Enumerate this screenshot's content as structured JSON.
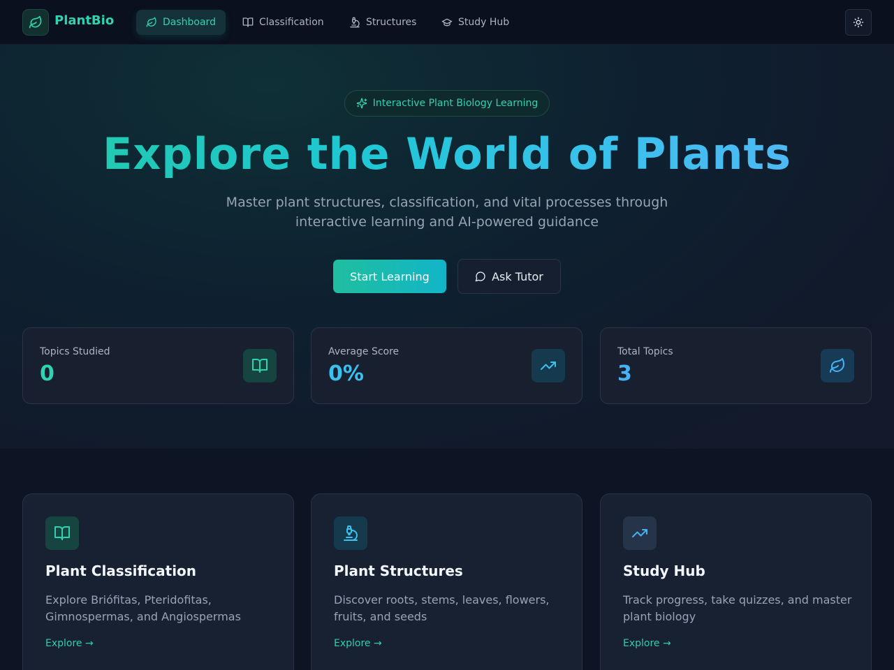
{
  "brand": {
    "name": "PlantBio",
    "logo_icon": "leaf-icon"
  },
  "nav": {
    "items": [
      {
        "label": "Dashboard",
        "icon": "leaf-icon",
        "active": true
      },
      {
        "label": "Classification",
        "icon": "book-icon",
        "active": false
      },
      {
        "label": "Structures",
        "icon": "microscope-icon",
        "active": false
      },
      {
        "label": "Study Hub",
        "icon": "graduation-cap-icon",
        "active": false
      }
    ],
    "theme_toggle_icon": "sun-icon"
  },
  "hero": {
    "badge": "Interactive Plant Biology Learning",
    "badge_icon": "sparkles-icon",
    "title": "Explore the World of Plants",
    "subtitle_line1": "Master plant structures, classification, and vital processes through",
    "subtitle_line2": "interactive learning and AI-powered guidance",
    "primary_button": "Start Learning",
    "secondary_button": "Ask Tutor",
    "secondary_icon": "message-circle-icon"
  },
  "stats": [
    {
      "label": "Topics Studied",
      "value": "0",
      "icon": "book-icon",
      "color": "#2ed3b0"
    },
    {
      "label": "Average Score",
      "value": "0%",
      "icon": "trending-up-icon",
      "color": "#3cc0ee"
    },
    {
      "label": "Total Topics",
      "value": "3",
      "icon": "leaf-icon",
      "color": "#46b2f4"
    }
  ],
  "features": [
    {
      "title": "Plant Classification",
      "description": "Explore Briófitas, Pteridofitas, Gimnospermas, and Angiospermas",
      "link": "Explore →",
      "icon": "book-icon"
    },
    {
      "title": "Plant Structures",
      "description": "Discover roots, stems, leaves, flowers, fruits, and seeds",
      "link": "Explore →",
      "icon": "microscope-icon"
    },
    {
      "title": "Study Hub",
      "description": "Track progress, take quizzes, and master plant biology",
      "link": "Explore →",
      "icon": "trending-up-icon"
    }
  ],
  "colors": {
    "accent": "#2ed3b0",
    "accent_blue": "#3cc0ee",
    "background": "#0d1424"
  }
}
